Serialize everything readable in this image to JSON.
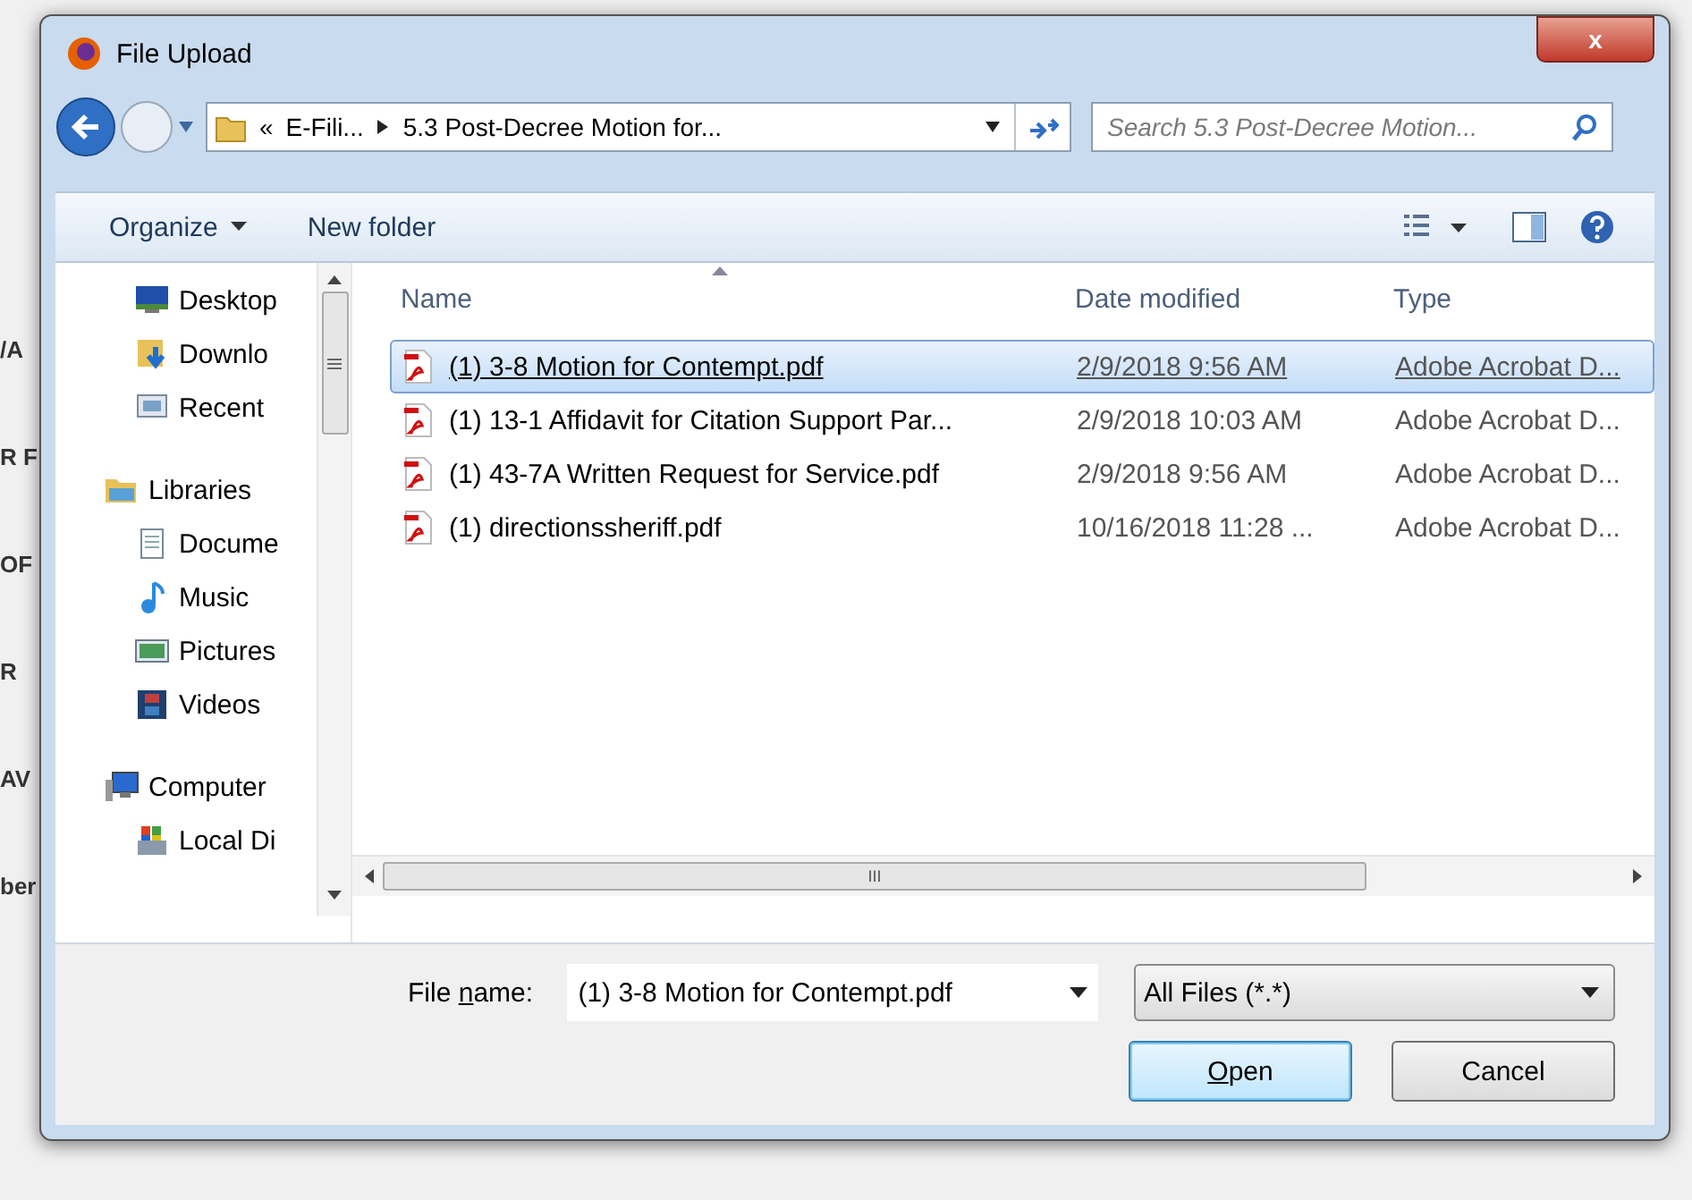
{
  "background_fragments": [
    "/A",
    "R F",
    "OF",
    "R",
    "AV",
    "ber"
  ],
  "window": {
    "title": "File Upload",
    "close": "x"
  },
  "address": {
    "overflow": "«",
    "crumbs": [
      "E-Fili...",
      "5.3 Post-Decree Motion for..."
    ]
  },
  "search": {
    "placeholder": "Search 5.3 Post-Decree Motion..."
  },
  "toolbar": {
    "organize": "Organize",
    "new_folder": "New folder"
  },
  "sidebar": {
    "sections": [
      {
        "children": [
          {
            "label": "Desktop"
          },
          {
            "label": "Downlo"
          },
          {
            "label": "Recent"
          }
        ]
      },
      {
        "label": "Libraries",
        "children": [
          {
            "label": "Docume"
          },
          {
            "label": "Music"
          },
          {
            "label": "Pictures"
          },
          {
            "label": "Videos"
          }
        ]
      },
      {
        "label": "Computer",
        "children": [
          {
            "label": "Local Di"
          }
        ]
      }
    ]
  },
  "table": {
    "columns": [
      "Name",
      "Date modified",
      "Type"
    ],
    "rows": [
      {
        "name": "(1) 3-8 Motion for Contempt.pdf",
        "date": "2/9/2018 9:56 AM",
        "type": "Adobe Acrobat D...",
        "selected": true
      },
      {
        "name": "(1) 13-1 Affidavit for Citation Support Par...",
        "date": "2/9/2018 10:03 AM",
        "type": "Adobe Acrobat D...",
        "selected": false
      },
      {
        "name": "(1) 43-7A Written Request for Service.pdf",
        "date": "2/9/2018 9:56 AM",
        "type": "Adobe Acrobat D...",
        "selected": false
      },
      {
        "name": "(1) directionssheriff.pdf",
        "date": "10/16/2018 11:28 ...",
        "type": "Adobe Acrobat D...",
        "selected": false
      }
    ]
  },
  "scrollbar_grip": "III",
  "file_name": {
    "label": "File **n**ame:",
    "value": "(1) 3-8 Motion for Contempt.pdf"
  },
  "filter": {
    "value": "All Files (*.*)"
  },
  "buttons": [
    {
      "label": "**O**pen",
      "default": true
    },
    {
      "label": "Cancel",
      "default": false
    }
  ]
}
